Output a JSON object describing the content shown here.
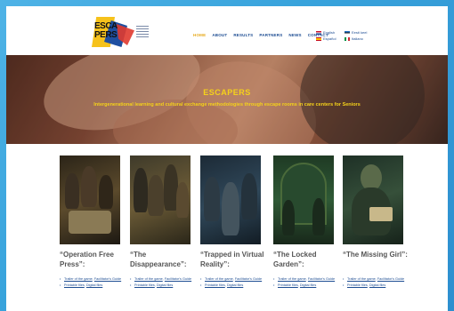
{
  "logo": {
    "text_line1": "ESCA",
    "text_line2": "PERS"
  },
  "nav": {
    "items": [
      {
        "label": "HOME",
        "active": true
      },
      {
        "label": "ABOUT",
        "active": false
      },
      {
        "label": "RESULTS",
        "active": false
      },
      {
        "label": "PARTNERS",
        "active": false
      },
      {
        "label": "NEWS",
        "active": false
      },
      {
        "label": "CONTACT",
        "active": false
      }
    ]
  },
  "languages": [
    {
      "label": "English",
      "flag": "flag-en-icon"
    },
    {
      "label": "Eesti keel",
      "flag": "flag-et-icon"
    },
    {
      "label": "Español",
      "flag": "flag-es-icon"
    },
    {
      "label": "Italiano",
      "flag": "flag-it-icon"
    }
  ],
  "hero": {
    "title": "ESCAPERS",
    "subtitle": "Intergenerational learning and cultural exchange methodologies through escape rooms in care centers for Seniors"
  },
  "cards": [
    {
      "title": "“Operation Free Press”:",
      "link1a": "Trailer of the game",
      "link1b": "Facilitator's Guide",
      "link2a": "Printable files",
      "link2b": "Digital files"
    },
    {
      "title": "“The Disappearance”:",
      "link1a": "Trailer of the game",
      "link1b": "Facilitator's Guide",
      "link2a": "Printable files",
      "link2b": "Digital files"
    },
    {
      "title": "“Trapped in Virtual Reality”:",
      "link1a": "Trailer of the game",
      "link1b": "Facilitator's Guide",
      "link2a": "Printable files",
      "link2b": "Digital files"
    },
    {
      "title": "“The Locked Garden”:",
      "link1a": "Trailer of the game",
      "link1b": "Facilitator's Guide",
      "link2a": "Printable files",
      "link2b": "Digital files"
    },
    {
      "title": "“The Missing Girl”:",
      "link1a": "Trailer of the game",
      "link1b": "Facilitator's Guide",
      "link2a": "Printable files",
      "link2b": "Digital files"
    }
  ],
  "colors": {
    "nav_text": "#1c4c92",
    "nav_active": "#e7a91b",
    "hero_text": "#f5d21a",
    "card_title": "#555555",
    "background": "#38a3dc"
  }
}
